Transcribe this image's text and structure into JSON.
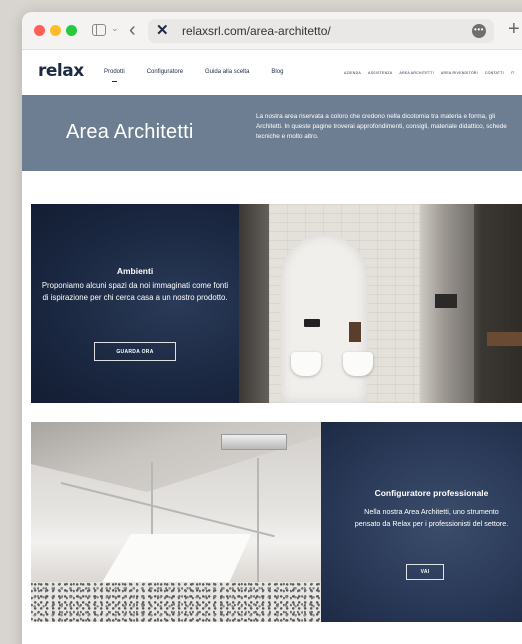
{
  "browser": {
    "url": "relaxsrl.com/area-architetto/",
    "more_label": "•••",
    "new_tab_label": "+"
  },
  "nav": {
    "logo": "relax",
    "main_items": [
      "Prodotti",
      "Configuratore",
      "Guida alla scelta",
      "Blog"
    ],
    "secondary_items": [
      "AZIENDA",
      "ASSISTENZA",
      "AREA ARCHITETTI",
      "AREA RIVENDITORI",
      "CONTATTI",
      "IT"
    ]
  },
  "banner": {
    "title": "Area Architetti",
    "description": "La nostra area riservata a coloro che credono nella dicotomia tra materia e forma, gli Architetti. In queste pagine troverai approfondimenti, consigli, materiale didattico, schede tecniche e molto altro."
  },
  "ambienti": {
    "title": "Ambienti",
    "text": "Proponiamo alcuni spazi da noi immaginati come fonti di ispirazione per chi cerca casa a un nostro prodotto.",
    "button": "GUARDA ORA"
  },
  "configuratore": {
    "title": "Configuratore professionale",
    "text": "Nella nostra Area Architetti, uno strumento pensato da Relax per i professionisti del settore.",
    "button": "VAI"
  },
  "colors": {
    "brand_navy": "#1d2a44",
    "banner_gray_blue": "#6e7e92"
  }
}
